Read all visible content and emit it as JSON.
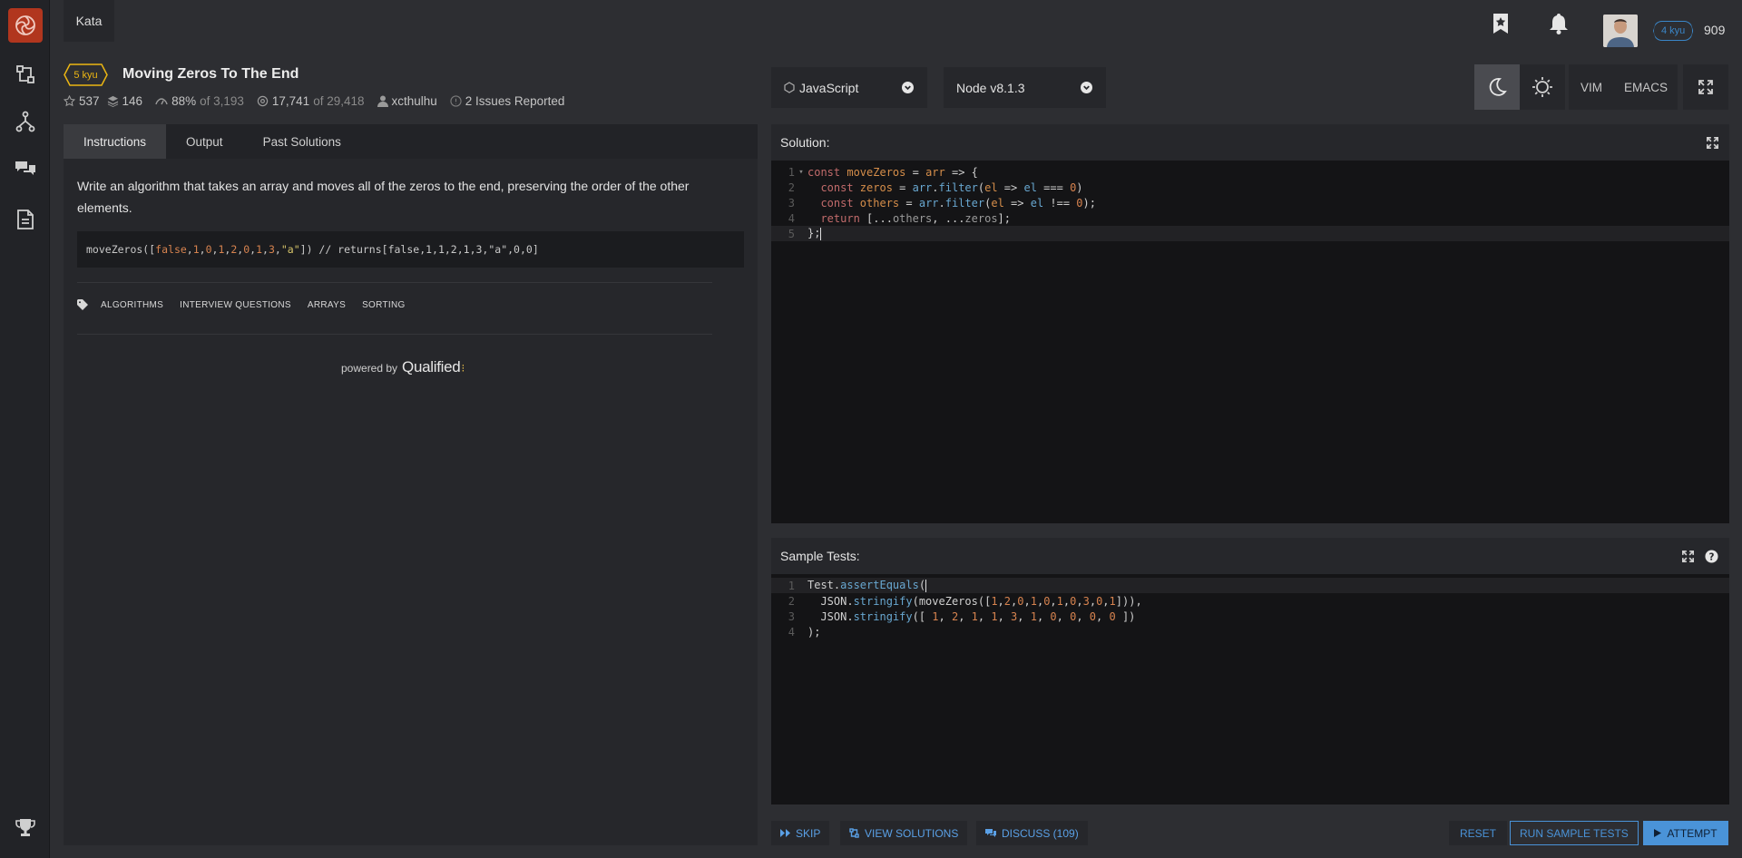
{
  "topbar": {
    "kata_tab": "Kata",
    "rank": "4 kyu",
    "honor": "909"
  },
  "kata": {
    "kyu": "5 kyu",
    "title": "Moving Zeros To The End",
    "stats": {
      "stars": "537",
      "collections": "146",
      "satisfaction": "88%",
      "satisfaction_of": "of 3,193",
      "completed": "17,741",
      "completed_of": "of 29,418",
      "author": "xcthulhu",
      "issues": "2 Issues Reported"
    }
  },
  "left_tabs": [
    "Instructions",
    "Output",
    "Past Solutions"
  ],
  "instructions": {
    "text": "Write an algorithm that takes an array and moves all of the zeros to the end, preserving the order of the other elements.",
    "example_parts": [
      "moveZeros([",
      "false",
      ",",
      "1",
      ",",
      "0",
      ",",
      "1",
      ",",
      "2",
      ",",
      "0",
      ",",
      "1",
      ",",
      "3",
      ",",
      "\"a\"",
      "]) // returns[false,1,1,2,1,3,\"a\",0,0]"
    ],
    "tags": [
      "ALGORITHMS",
      "INTERVIEW QUESTIONS",
      "ARRAYS",
      "SORTING"
    ],
    "powered_by": "powered by",
    "qualified": "Qualified"
  },
  "editor": {
    "language": "JavaScript",
    "version": "Node v8.1.3",
    "vim": "VIM",
    "emacs": "EMACS",
    "solution_label": "Solution:",
    "tests_label": "Sample Tests:"
  },
  "solution_lines": [
    [
      [
        "k",
        "const "
      ],
      [
        "v",
        "moveZeros"
      ],
      [
        "p",
        " = "
      ],
      [
        "v",
        "arr"
      ],
      [
        "p",
        " => {"
      ]
    ],
    [
      [
        "k",
        "  const "
      ],
      [
        "v",
        "zeros"
      ],
      [
        "p",
        " = "
      ],
      [
        "f",
        "arr"
      ],
      [
        "p",
        "."
      ],
      [
        "f",
        "filter"
      ],
      [
        "p",
        "("
      ],
      [
        "v",
        "el"
      ],
      [
        "p",
        " => "
      ],
      [
        "f",
        "el"
      ],
      [
        "p",
        " === "
      ],
      [
        "n",
        "0"
      ],
      [
        "p",
        ")"
      ]
    ],
    [
      [
        "k",
        "  const "
      ],
      [
        "v",
        "others"
      ],
      [
        "p",
        " = "
      ],
      [
        "f",
        "arr"
      ],
      [
        "p",
        "."
      ],
      [
        "f",
        "filter"
      ],
      [
        "p",
        "("
      ],
      [
        "v",
        "el"
      ],
      [
        "p",
        " => "
      ],
      [
        "f",
        "el"
      ],
      [
        "p",
        " !== "
      ],
      [
        "n",
        "0"
      ],
      [
        "p",
        ");"
      ]
    ],
    [
      [
        "k",
        "  return "
      ],
      [
        "p",
        "[..."
      ],
      [
        "c",
        "others"
      ],
      [
        "p",
        ", ..."
      ],
      [
        "c",
        "zeros"
      ],
      [
        "p",
        "];"
      ]
    ],
    [
      [
        "p",
        "};"
      ]
    ]
  ],
  "test_lines": [
    [
      [
        "p",
        "Test."
      ],
      [
        "f",
        "assertEquals"
      ],
      [
        "p",
        "("
      ]
    ],
    [
      [
        "p",
        "  JSON."
      ],
      [
        "f",
        "stringify"
      ],
      [
        "p",
        "(moveZeros(["
      ],
      [
        "n",
        "1"
      ],
      [
        "p",
        ","
      ],
      [
        "n",
        "2"
      ],
      [
        "p",
        ","
      ],
      [
        "n",
        "0"
      ],
      [
        "p",
        ","
      ],
      [
        "n",
        "1"
      ],
      [
        "p",
        ","
      ],
      [
        "n",
        "0"
      ],
      [
        "p",
        ","
      ],
      [
        "n",
        "1"
      ],
      [
        "p",
        ","
      ],
      [
        "n",
        "0"
      ],
      [
        "p",
        ","
      ],
      [
        "n",
        "3"
      ],
      [
        "p",
        ","
      ],
      [
        "n",
        "0"
      ],
      [
        "p",
        ","
      ],
      [
        "n",
        "1"
      ],
      [
        "p",
        "])),"
      ]
    ],
    [
      [
        "p",
        "  JSON."
      ],
      [
        "f",
        "stringify"
      ],
      [
        "p",
        "([ "
      ],
      [
        "n",
        "1"
      ],
      [
        "p",
        ", "
      ],
      [
        "n",
        "2"
      ],
      [
        "p",
        ", "
      ],
      [
        "n",
        "1"
      ],
      [
        "p",
        ", "
      ],
      [
        "n",
        "1"
      ],
      [
        "p",
        ", "
      ],
      [
        "n",
        "3"
      ],
      [
        "p",
        ", "
      ],
      [
        "n",
        "1"
      ],
      [
        "p",
        ", "
      ],
      [
        "n",
        "0"
      ],
      [
        "p",
        ", "
      ],
      [
        "n",
        "0"
      ],
      [
        "p",
        ", "
      ],
      [
        "n",
        "0"
      ],
      [
        "p",
        ", "
      ],
      [
        "n",
        "0"
      ],
      [
        "p",
        " ])"
      ]
    ],
    [
      [
        "p",
        ");"
      ]
    ]
  ],
  "bottom": {
    "skip": "SKIP",
    "view_solutions": "VIEW SOLUTIONS",
    "discuss": "DISCUSS (109)",
    "reset": "RESET",
    "run": "RUN SAMPLE TESTS",
    "attempt": "ATTEMPT"
  }
}
